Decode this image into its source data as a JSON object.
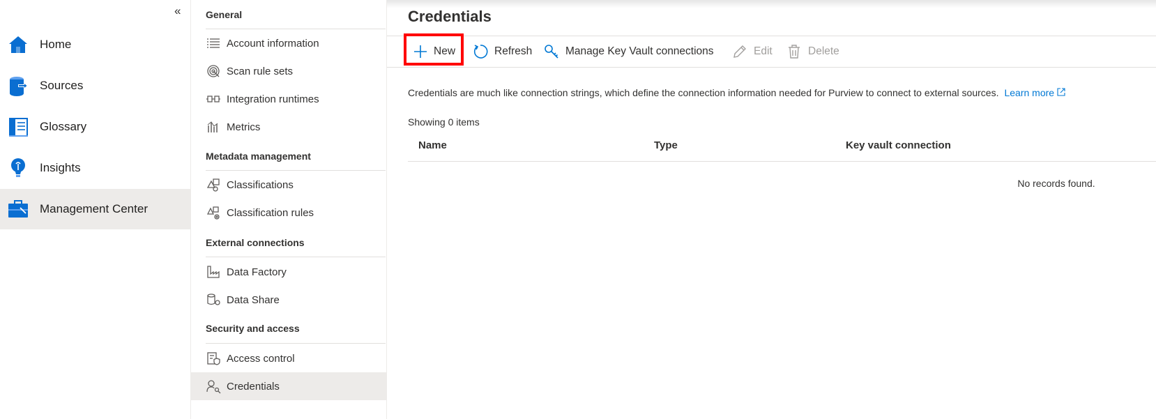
{
  "leftnav": {
    "collapse_glyph": "«",
    "items": [
      {
        "label": "Home",
        "icon": "home-icon"
      },
      {
        "label": "Sources",
        "icon": "sources-icon"
      },
      {
        "label": "Glossary",
        "icon": "glossary-icon"
      },
      {
        "label": "Insights",
        "icon": "insights-icon"
      },
      {
        "label": "Management Center",
        "icon": "toolbox-icon",
        "selected": true
      }
    ]
  },
  "menu": {
    "sections": [
      {
        "title": "General",
        "items": [
          "Account information",
          "Scan rule sets",
          "Integration runtimes",
          "Metrics"
        ]
      },
      {
        "title": "Metadata management",
        "items": [
          "Classifications",
          "Classification rules"
        ]
      },
      {
        "title": "External connections",
        "items": [
          "Data Factory",
          "Data Share"
        ]
      },
      {
        "title": "Security and access",
        "items": [
          "Access control",
          "Credentials"
        ]
      }
    ],
    "selected": "Credentials"
  },
  "main": {
    "title": "Credentials",
    "toolbar": {
      "new": "New",
      "refresh": "Refresh",
      "manage": "Manage Key Vault connections",
      "edit": "Edit",
      "delete": "Delete"
    },
    "description": "Credentials are much like connection strings, which define the connection information needed for Purview to connect to external sources.",
    "learn_more": "Learn more",
    "count": "Showing 0 items",
    "columns": [
      "Name",
      "Type",
      "Key vault connection"
    ],
    "empty": "No records found."
  },
  "colors": {
    "accent": "#0078d4",
    "highlight": "#ff0000",
    "selected_bg": "#edebe9"
  }
}
